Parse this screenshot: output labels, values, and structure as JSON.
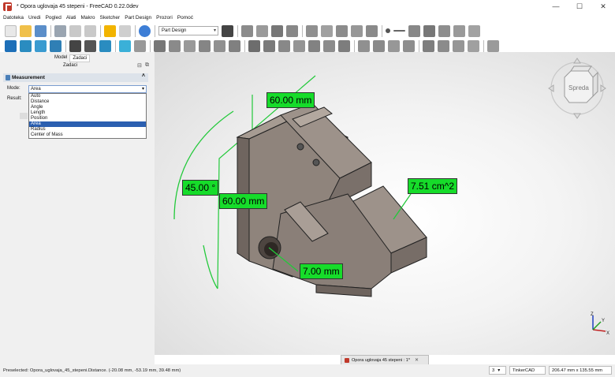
{
  "window": {
    "title": "* Opora uglovaja 45 stepeni - FreeCAD 0.22.0dev",
    "minimize": "—",
    "maximize": "☐",
    "close": "✕"
  },
  "menu": [
    "Datoteka",
    "Uredi",
    "Pogled",
    "Alati",
    "Makro",
    "Sketcher",
    "Part Design",
    "Prozori",
    "Pomoć"
  ],
  "workbench": {
    "selected": "Part Design"
  },
  "panel": {
    "tabs": [
      "Model",
      "Zadaci"
    ],
    "active_tab": "Zadaci",
    "section_label": "Zadaci",
    "measurement": {
      "title": "Measurement",
      "mode_label": "Mode:",
      "mode_value": "Area",
      "result_label": "Result:",
      "options": [
        "Auto",
        "Distance",
        "Angle",
        "Length",
        "Position",
        "Area",
        "Radius",
        "Center of Mass"
      ],
      "selected_index": 5
    }
  },
  "measurements": {
    "top_distance": "60.00 mm",
    "angle": "45.00 °",
    "side_distance": "60.00 mm",
    "area": "7.51 cm^2",
    "radius": "7.00 mm"
  },
  "navcube": {
    "face_label": "Spreda"
  },
  "axes": {
    "x": "X",
    "y": "Y",
    "z": "Z"
  },
  "document_tab": {
    "label": "Opora uglovaja 45 stepeni : 1*",
    "close": "✕"
  },
  "status": {
    "preselected": "Preselected: Opora_uglovaja_45_stepeni.Distance. (-20.08 mm, -53.19 mm, 39.48 mm)",
    "view_count": "3",
    "nav_style": "TinkerCAD",
    "dimensions": "206.47 mm x 135.55 mm"
  },
  "colors": {
    "measure_label": "#16dc2a",
    "part": "#8a7f78",
    "selection": "#2b5fb0"
  }
}
